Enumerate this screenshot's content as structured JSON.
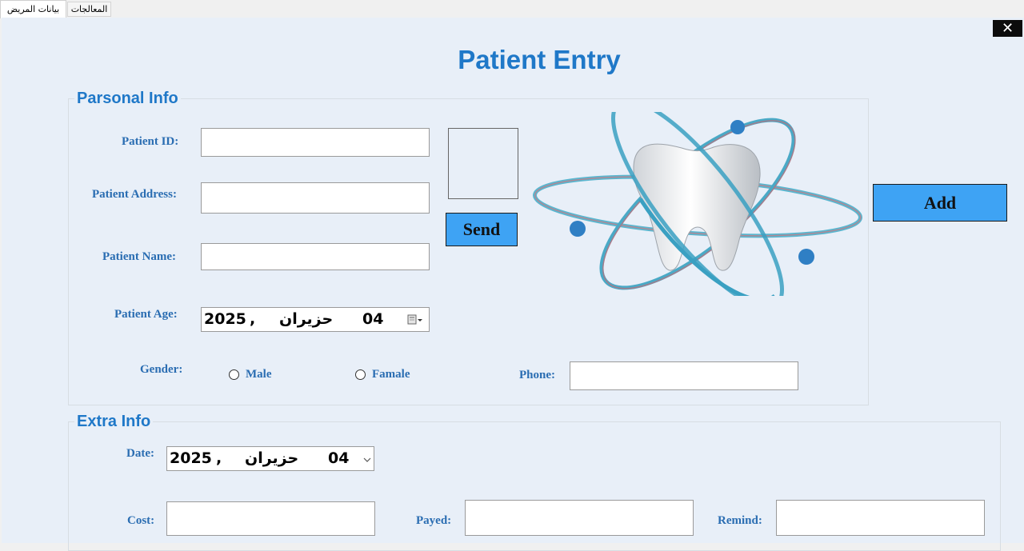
{
  "tabs": [
    {
      "label": "بيانات المريض",
      "active": true
    },
    {
      "label": "المعالجات",
      "active": false
    }
  ],
  "window": {
    "close_glyph": "✕"
  },
  "title": "Patient Entry",
  "personal": {
    "title": "Parsonal Info",
    "patient_id_label": "Patient ID:",
    "patient_id_value": "",
    "address_label": "Patient Address:",
    "address_value": "",
    "name_label": "Patient Name:",
    "name_value": "",
    "age_label": "Patient Age:",
    "age_year": "2025",
    "age_comma": ",",
    "age_month": "حزيران",
    "age_day": "04",
    "gender_label": "Gender:",
    "male_label": "Male",
    "female_label": "Famale",
    "phone_label": "Phone:",
    "phone_value": "",
    "send_label": "Send",
    "add_label": "Add"
  },
  "extra": {
    "title": "Extra Info",
    "date_label": "Date:",
    "date_year": "2025",
    "date_comma": ",",
    "date_month": "حزيران",
    "date_day": "04",
    "cost_label": "Cost:",
    "cost_value": "",
    "payed_label": "Payed:",
    "payed_value": "",
    "remind_label": "Remind:",
    "remind_value": ""
  },
  "colors": {
    "accent": "#1f78c8",
    "label": "#2a6db2",
    "button": "#3ea3f4",
    "panel": "#e8eff8"
  },
  "icons": {
    "logo": "tooth-atom-logo",
    "calendar": "calendar-icon",
    "dropdown": "chevron-down-icon",
    "close": "close-icon"
  }
}
